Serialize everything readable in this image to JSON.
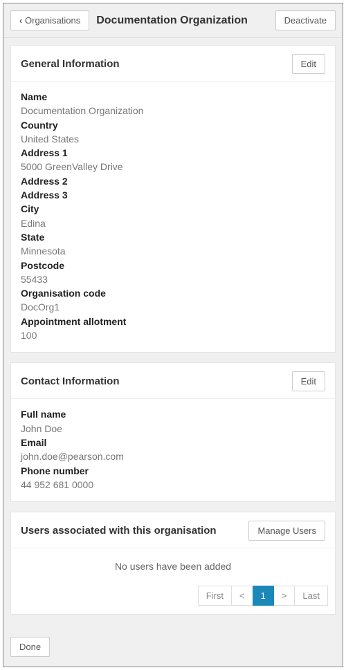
{
  "header": {
    "back_label": "Organisations",
    "title": "Documentation Organization",
    "deactivate_label": "Deactivate"
  },
  "general": {
    "section_title": "General Information",
    "edit_label": "Edit",
    "labels": {
      "name": "Name",
      "country": "Country",
      "address1": "Address 1",
      "address2": "Address 2",
      "address3": "Address 3",
      "city": "City",
      "state": "State",
      "postcode": "Postcode",
      "org_code": "Organisation code",
      "allotment": "Appointment allotment"
    },
    "values": {
      "name": "Documentation Organization",
      "country": "United States",
      "address1": "5000 GreenValley Drive",
      "address2": "",
      "address3": "",
      "city": "Edina",
      "state": "Minnesota",
      "postcode": "55433",
      "org_code": "DocOrg1",
      "allotment": "100"
    }
  },
  "contact": {
    "section_title": "Contact Information",
    "edit_label": "Edit",
    "labels": {
      "full_name": "Full name",
      "email": "Email",
      "phone": "Phone number"
    },
    "values": {
      "full_name": "John Doe",
      "email": "john.doe@pearson.com",
      "phone": "44 952 681 0000"
    }
  },
  "users": {
    "section_title": "Users associated with this organisation",
    "manage_label": "Manage Users",
    "empty_message": "No users have been added",
    "pagination": {
      "first": "First",
      "prev": "<",
      "current": "1",
      "next": ">",
      "last": "Last"
    }
  },
  "footer": {
    "done_label": "Done"
  }
}
